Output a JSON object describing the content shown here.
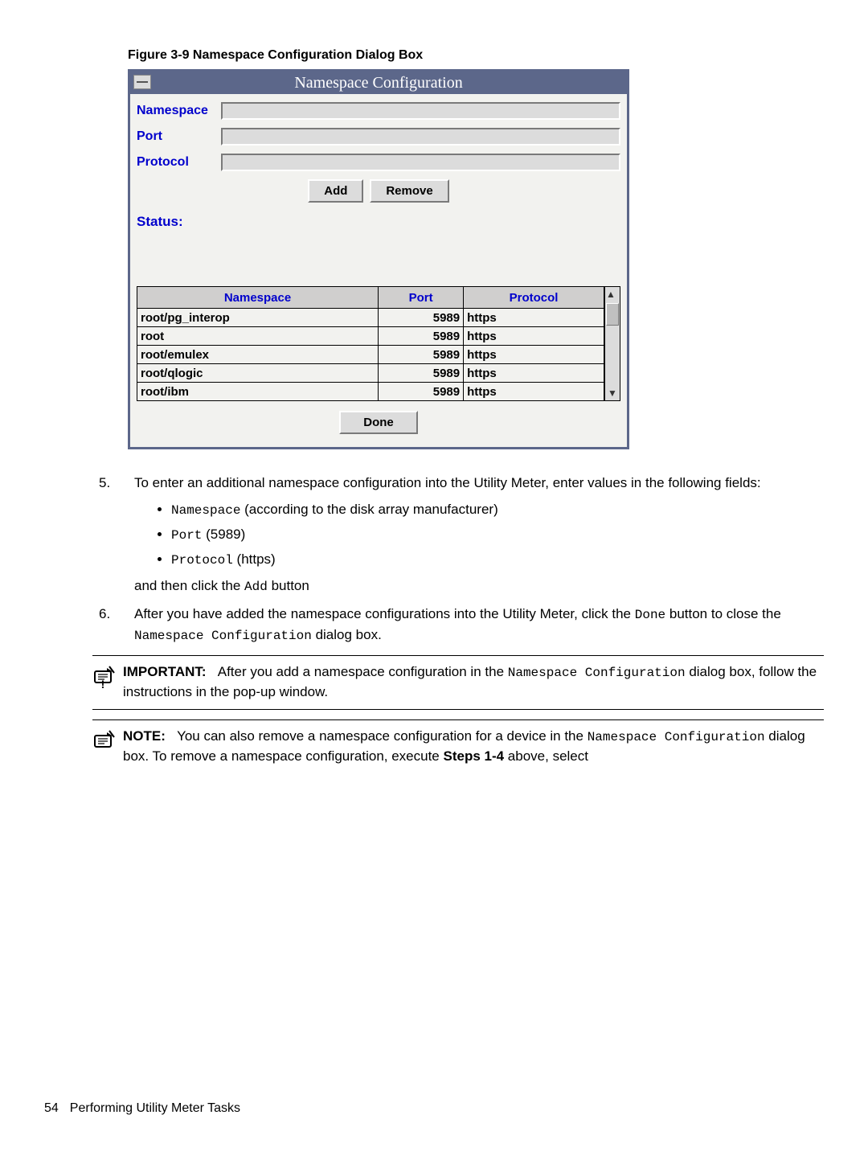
{
  "figure_caption": "Figure 3-9 Namespace Configuration Dialog Box",
  "dialog": {
    "title": "Namespace Configuration",
    "labels": {
      "namespace": "Namespace",
      "port": "Port",
      "protocol": "Protocol"
    },
    "buttons": {
      "add": "Add",
      "remove": "Remove",
      "done": "Done"
    },
    "status_label": "Status:",
    "table": {
      "headers": {
        "namespace": "Namespace",
        "port": "Port",
        "protocol": "Protocol"
      },
      "rows": [
        {
          "namespace": "root/pg_interop",
          "port": "5989",
          "protocol": "https"
        },
        {
          "namespace": "root",
          "port": "5989",
          "protocol": "https"
        },
        {
          "namespace": "root/emulex",
          "port": "5989",
          "protocol": "https"
        },
        {
          "namespace": "root/qlogic",
          "port": "5989",
          "protocol": "https"
        },
        {
          "namespace": "root/ibm",
          "port": "5989",
          "protocol": "https"
        }
      ]
    }
  },
  "steps": {
    "s5_num": "5.",
    "s5_intro": "To enter an additional namespace configuration into the Utility Meter, enter values in the following fields:",
    "s5_b1_code": "Namespace",
    "s5_b1_tail": " (according to the disk array manufacturer)",
    "s5_b2_code": "Port",
    "s5_b2_tail": " (5989)",
    "s5_b3_code": "Protocol",
    "s5_b3_tail": " (https)",
    "s5_then_a": "and then click the ",
    "s5_then_code": "Add",
    "s5_then_b": " button",
    "s6_num": "6.",
    "s6_a": "After you have added the namespace configurations into the Utility Meter, click the ",
    "s6_code1": "Done",
    "s6_b": " button to close the ",
    "s6_code2": "Namespace Configuration",
    "s6_c": " dialog box."
  },
  "callouts": {
    "important_label": "IMPORTANT:",
    "important_a": "After you add a namespace configuration in the ",
    "important_code": "Namespace Configuration",
    "important_b": " dialog box, follow the instructions in the pop-up window.",
    "note_label": "NOTE:",
    "note_a": "You can also remove a namespace configuration for a device in the ",
    "note_code": "Namespace Configuration",
    "note_b": " dialog box. To remove a namespace configuration, execute ",
    "note_bold": "Steps 1-4",
    "note_c": " above, select"
  },
  "footer": {
    "page": "54",
    "title": "Performing Utility Meter Tasks"
  }
}
